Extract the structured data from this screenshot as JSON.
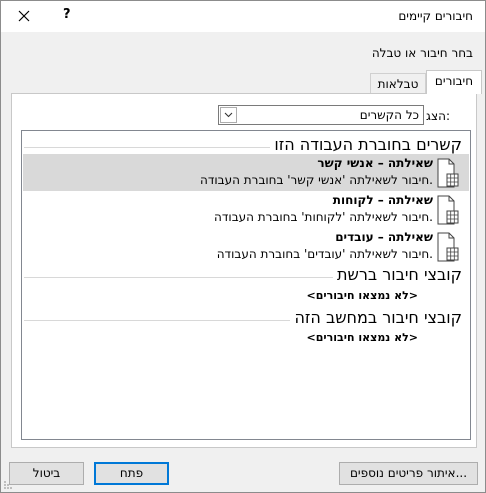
{
  "window": {
    "title": "חיבורים קיימים",
    "help_label": "?"
  },
  "instruction": "בחר חיבור או טבלה",
  "tabs": [
    {
      "label": "חיבורים",
      "active": true
    },
    {
      "label": "טבלאות",
      "active": false
    }
  ],
  "show": {
    "label": "הצג:",
    "value": "כל הקשרים"
  },
  "sections": [
    {
      "title": "קשרים בחוברת העבודה הזו",
      "items": [
        {
          "name": "שאילתה – אנשי קשר",
          "desc": "חיבור לשאילתה 'אנשי קשר' בחוברת העבודה.",
          "selected": true
        },
        {
          "name": "שאילתה – לקוחות",
          "desc": "חיבור לשאילתה 'לקוחות' בחוברת העבודה.",
          "selected": false
        },
        {
          "name": "שאילתה – עובדים",
          "desc": "חיבור לשאילתה 'עובדים' בחוברת העבודה.",
          "selected": false
        }
      ]
    },
    {
      "title": "קובצי חיבור ברשת",
      "empty_text": "<לא נמצאו חיבורים>"
    },
    {
      "title": "קובצי חיבור במחשב הזה",
      "empty_text": "<לא נמצאו חיבורים>"
    }
  ],
  "buttons": {
    "browse": "איתור פריטים נוספים...",
    "open": "פתח",
    "cancel": "ביטול"
  }
}
